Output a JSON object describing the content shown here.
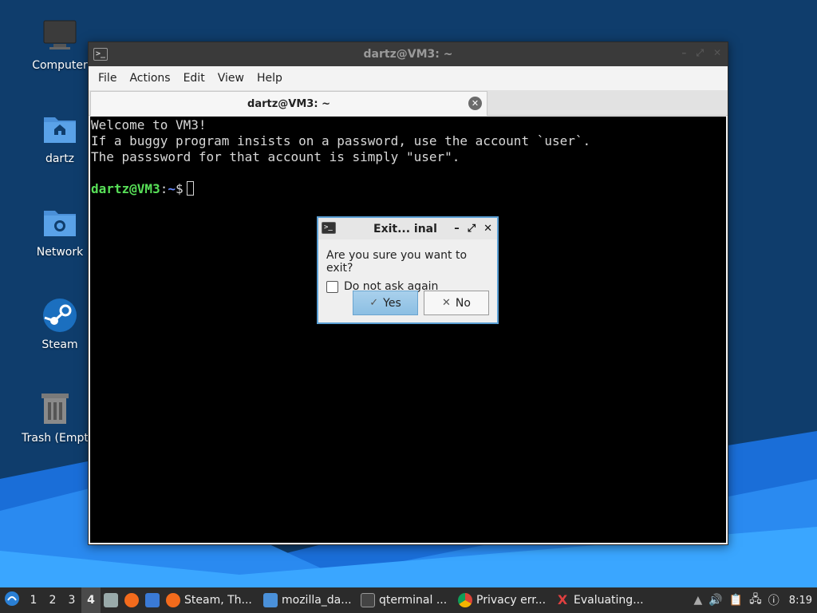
{
  "desktop": {
    "icons": [
      {
        "label": "Computer",
        "icon": "computer-icon"
      },
      {
        "label": "dartz",
        "icon": "home-folder-icon"
      },
      {
        "label": "Network",
        "icon": "network-folder-icon"
      },
      {
        "label": "Steam",
        "icon": "steam-icon"
      },
      {
        "label": "Trash (Empt",
        "icon": "trash-icon"
      }
    ]
  },
  "window": {
    "title": "dartz@VM3: ~",
    "menu": [
      "File",
      "Actions",
      "Edit",
      "View",
      "Help"
    ],
    "tab_label": "dartz@VM3: ~",
    "terminal": {
      "lines": [
        "Welcome to VM3!",
        "If a buggy program insists on a password, use the account `user`.",
        "The passsword for that account is simply \"user\"."
      ],
      "prompt_user": "dartz@VM3",
      "prompt_sep": ":",
      "prompt_path": "~",
      "prompt_symbol": "$"
    }
  },
  "dialog": {
    "title": "Exit...  inal",
    "message": "Are you sure you want to exit?",
    "checkbox_label": "Do not ask again",
    "checkbox_checked": false,
    "yes_label": "Yes",
    "no_label": "No"
  },
  "taskbar": {
    "workspaces": [
      "1",
      "2",
      "3",
      "4"
    ],
    "active_workspace": "4",
    "tasks": [
      {
        "label": "Steam, Th...",
        "icon": "firefox-icon"
      },
      {
        "label": "mozilla_da...",
        "icon": "folder-icon"
      },
      {
        "label": "qterminal ...",
        "icon": "terminal-icon"
      },
      {
        "label": "Privacy err...",
        "icon": "chrome-icon"
      },
      {
        "label": "Evaluating...",
        "icon": "x-app-icon"
      }
    ],
    "clock": "8:19"
  },
  "colors": {
    "accent": "#5a9fd4",
    "prompt_user": "#58e058",
    "prompt_path": "#6a8cff"
  }
}
